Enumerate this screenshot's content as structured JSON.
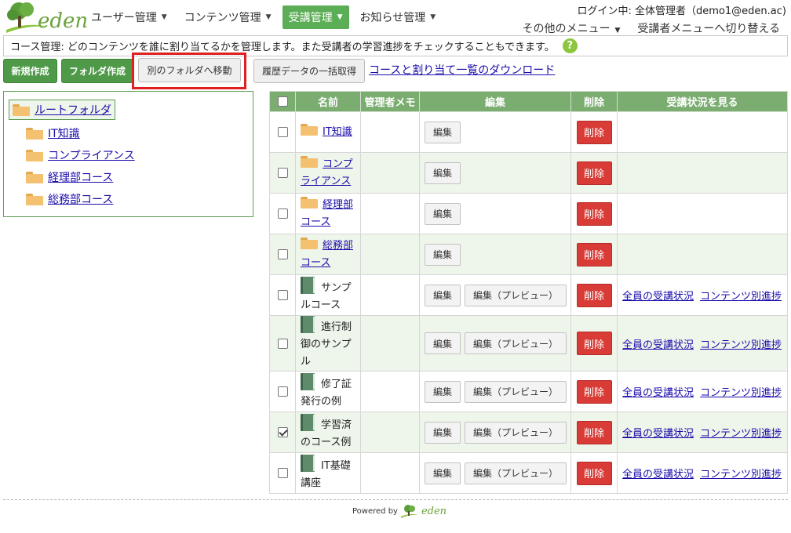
{
  "header": {
    "logo_text": "eden",
    "nav": [
      {
        "label": "ユーザー管理"
      },
      {
        "label": "コンテンツ管理"
      },
      {
        "label": "受講管理"
      },
      {
        "label": "お知らせ管理"
      }
    ],
    "login_info": "ログイン中: 全体管理者（demo1@eden.ac)",
    "other_menu": "その他のメニュー",
    "switch_menu": "受講者メニューへ切り替える"
  },
  "infobar": {
    "text": "コース管理: どのコンテンツを誰に割り当てるかを管理します。また受講者の学習進捗をチェックすることもできます。",
    "help_glyph": "?"
  },
  "toolbar": {
    "new_label": "新規作成",
    "folder_label": "フォルダ作成",
    "move_label": "別のフォルダへ移動",
    "history_label": "履歴データの一括取得",
    "download_link": "コースと割り当て一覧のダウンロード"
  },
  "tree": {
    "root": "ルートフォルダ",
    "items": [
      {
        "label": "IT知識"
      },
      {
        "label": "コンプライアンス"
      },
      {
        "label": "経理部コース"
      },
      {
        "label": "総務部コース"
      }
    ]
  },
  "table": {
    "headers": {
      "name": "名前",
      "memo": "管理者メモ",
      "edit": "編集",
      "delete": "削除",
      "status": "受講状況を見る"
    },
    "edit_label": "編集",
    "preview_label": "編集（プレビュー）",
    "delete_label": "削除",
    "all_status_label": "全員の受講状況",
    "per_content_label": "コンテンツ別進捗",
    "rows": [
      {
        "name_lines": [
          "IT知識"
        ],
        "type": "folder",
        "checked": false
      },
      {
        "name_lines": [
          "コンプ",
          "ライアンス"
        ],
        "type": "folder",
        "checked": false
      },
      {
        "name_lines": [
          "経理部",
          "コース"
        ],
        "type": "folder",
        "checked": false
      },
      {
        "name_lines": [
          "総務部",
          "コース"
        ],
        "type": "folder",
        "checked": false
      },
      {
        "name_lines": [
          "サンプ",
          "ルコース"
        ],
        "type": "course",
        "checked": false
      },
      {
        "name_lines": [
          "進行制",
          "御のサンプ",
          "ル"
        ],
        "type": "course",
        "checked": false
      },
      {
        "name_lines": [
          "修了証",
          "発行の例"
        ],
        "type": "course",
        "checked": false
      },
      {
        "name_lines": [
          "学習済",
          "のコース例"
        ],
        "type": "course",
        "checked": true
      },
      {
        "name_lines": [
          "IT基礎",
          "講座"
        ],
        "type": "course",
        "checked": false
      }
    ]
  },
  "footer": {
    "powered_by": "Powered by",
    "logo_text": "eden"
  },
  "colors": {
    "brand_green": "#5cae56",
    "header_green": "#7bad70",
    "delete_red": "#d93b36",
    "link_blue": "#1a0dab",
    "highlight_red": "#e02020"
  }
}
